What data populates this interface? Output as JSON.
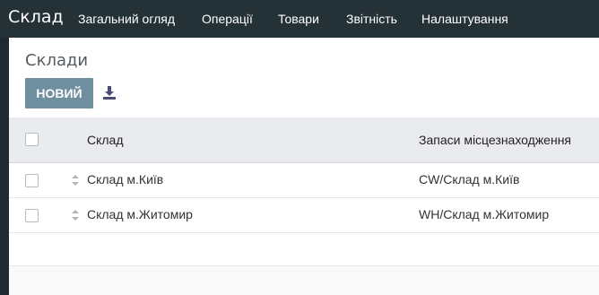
{
  "app": {
    "title": "Склад"
  },
  "menu": {
    "items": [
      {
        "label": "Загальний огляд"
      },
      {
        "label": "Операції"
      },
      {
        "label": "Товари"
      },
      {
        "label": "Звітність"
      },
      {
        "label": "Налаштування"
      }
    ]
  },
  "page": {
    "breadcrumb": "Склади",
    "new_button": "НОВИЙ"
  },
  "table": {
    "columns": [
      "Склад",
      "Запаси місцезнаходження"
    ],
    "rows": [
      {
        "name": "Склад м.Київ",
        "location": "CW/Склад м.Київ"
      },
      {
        "name": "Склад м.Житомир",
        "location": "WH/Склад м.Житомир"
      }
    ]
  },
  "colors": {
    "topbar": "#243137",
    "primary_button": "#6f8f9f",
    "header_bg": "#e9ebee"
  }
}
